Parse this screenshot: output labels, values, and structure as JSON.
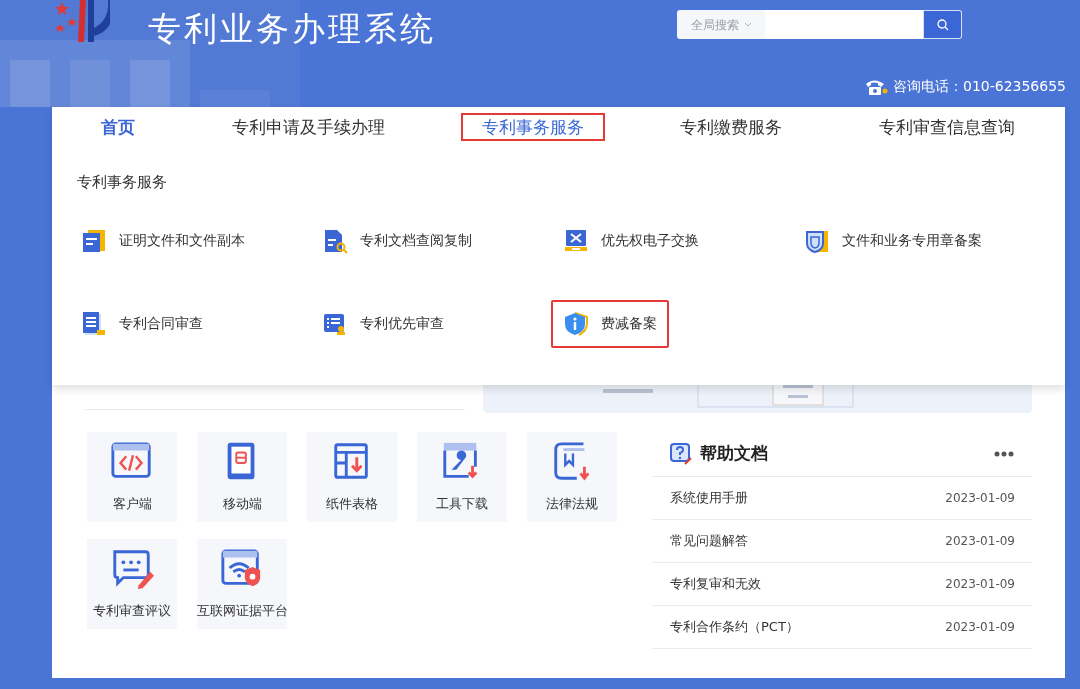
{
  "header": {
    "title": "专利业务办理系统",
    "search": {
      "scope": "全局搜索"
    },
    "phone": "咨询电话：010-62356655"
  },
  "nav": [
    {
      "label": "首页",
      "selected": true,
      "highlighted": false
    },
    {
      "label": "专利申请及手续办理",
      "selected": false,
      "highlighted": false
    },
    {
      "label": "专利事务服务",
      "selected": false,
      "highlighted": true
    },
    {
      "label": "专利缴费服务",
      "selected": false,
      "highlighted": false
    },
    {
      "label": "专利审查信息查询",
      "selected": false,
      "highlighted": false
    }
  ],
  "menu": {
    "heading": "专利事务服务",
    "items": [
      {
        "label": "证明文件和文件副本",
        "highlighted": false
      },
      {
        "label": "专利文档查阅复制",
        "highlighted": false
      },
      {
        "label": "优先权电子交换",
        "highlighted": false
      },
      {
        "label": "文件和业务专用章备案",
        "highlighted": false
      },
      {
        "label": "专利合同审查",
        "highlighted": false
      },
      {
        "label": "专利优先审查",
        "highlighted": false
      },
      {
        "label": "费减备案",
        "highlighted": true
      }
    ]
  },
  "quick_links": [
    "客户端",
    "移动端",
    "纸件表格",
    "工具下载",
    "法律法规",
    "专利审查评议",
    "互联网证据平台"
  ],
  "help": {
    "title": "帮助文档",
    "rows": [
      {
        "title": "系统使用手册",
        "date": "2023-01-09"
      },
      {
        "title": "常见问题解答",
        "date": "2023-01-09"
      },
      {
        "title": "专利复审和无效",
        "date": "2023-01-09"
      },
      {
        "title": "专利合作条约（PCT）",
        "date": "2023-01-09"
      }
    ]
  }
}
